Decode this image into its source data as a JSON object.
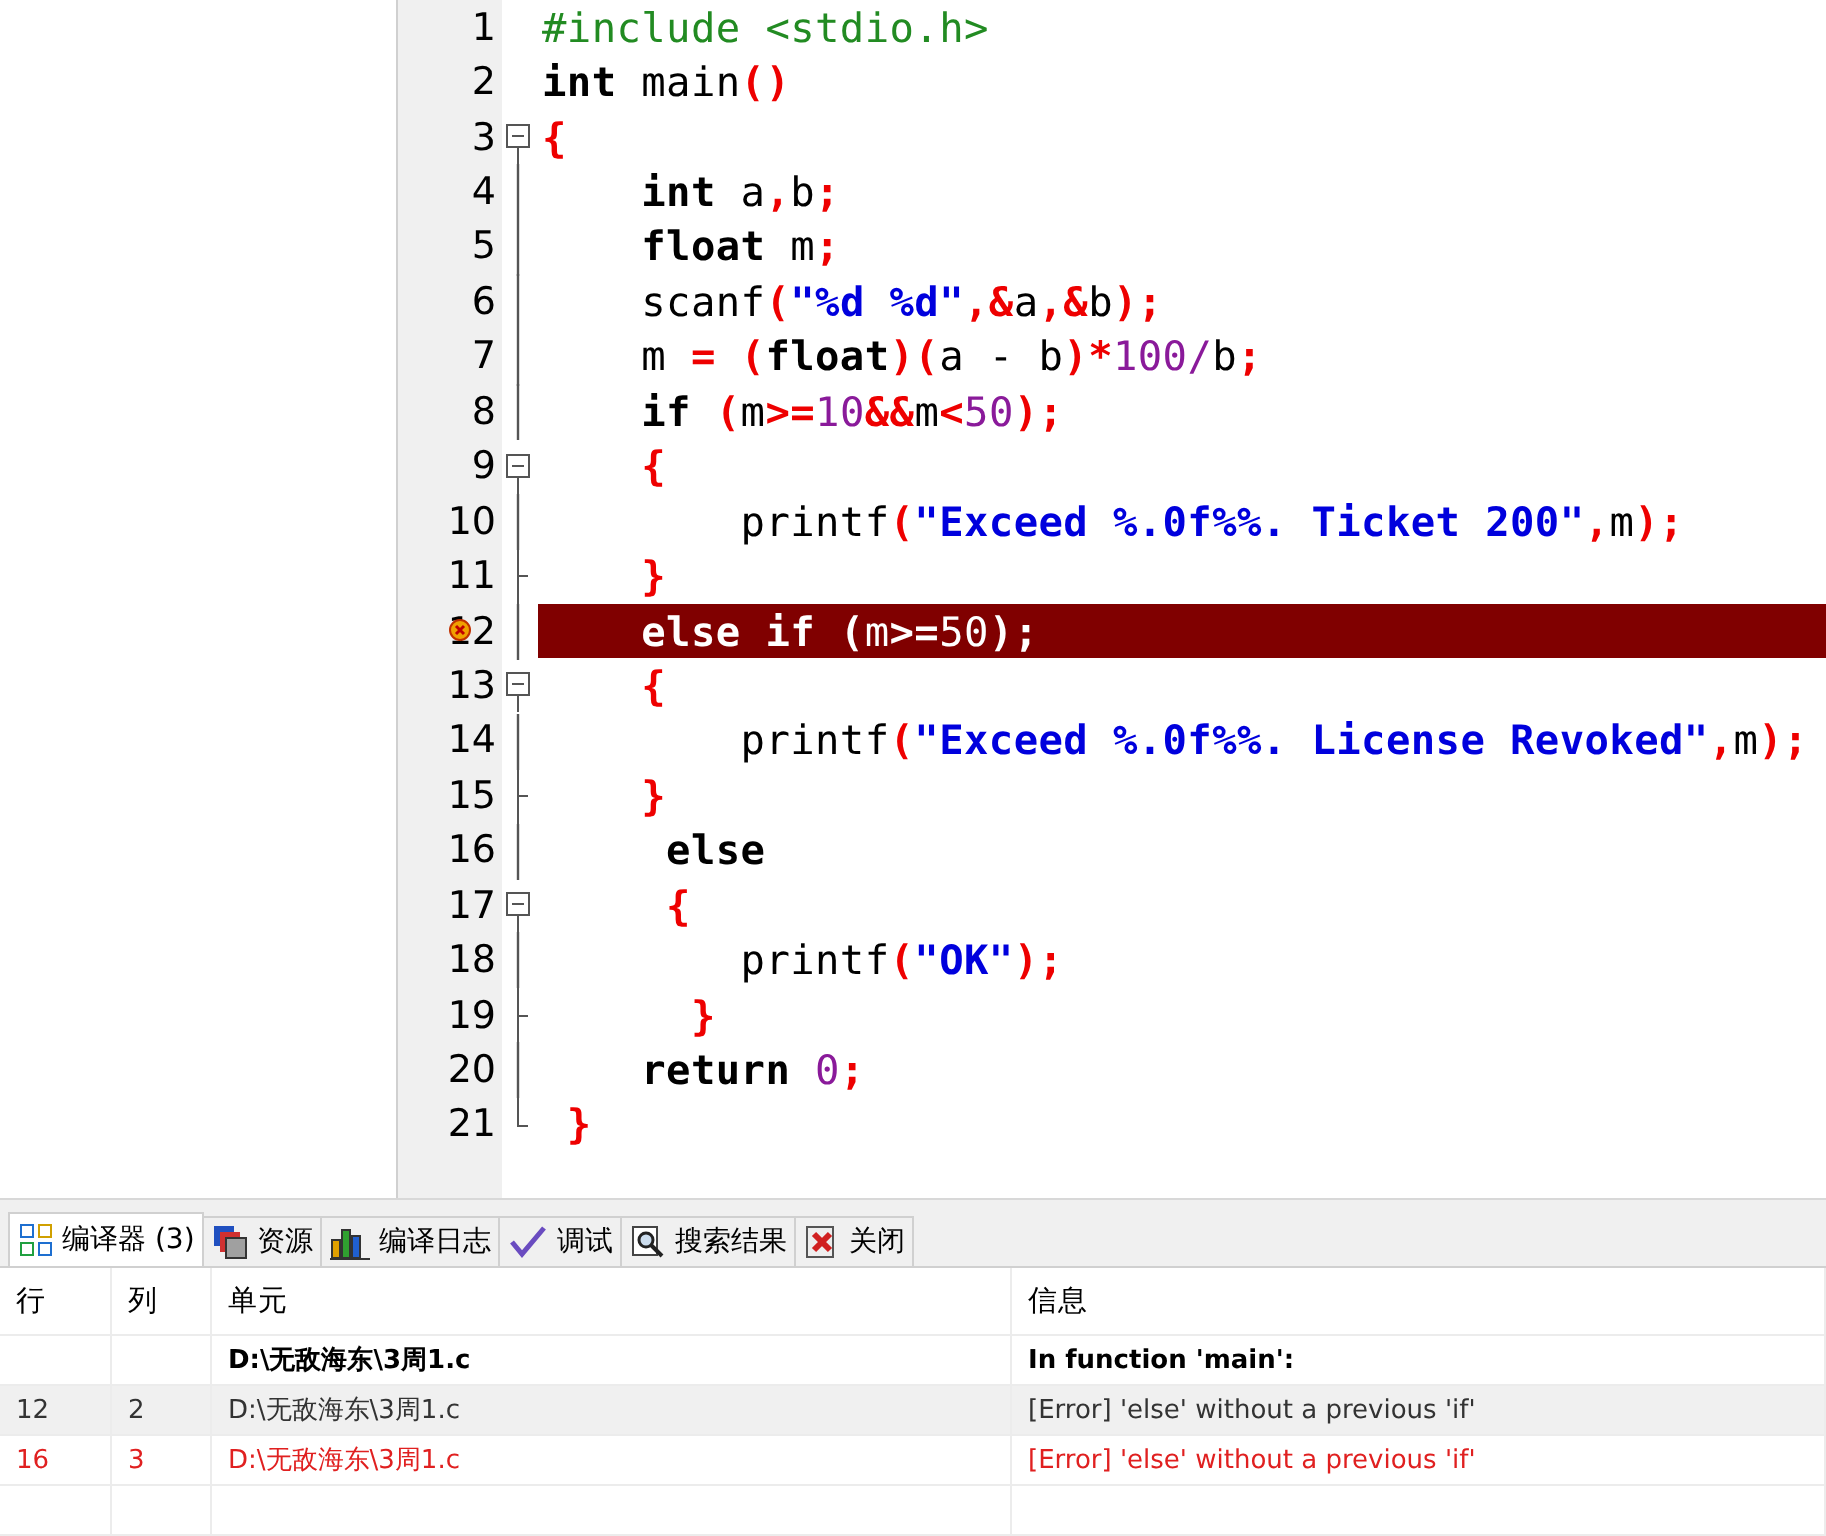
{
  "editor": {
    "lines": [
      {
        "number": "1",
        "kind": "none",
        "error": false,
        "tokens": [
          {
            "kind": "preproc",
            "text": "#include <stdio.h>"
          }
        ]
      },
      {
        "number": "2",
        "kind": "none",
        "error": false,
        "tokens": [
          {
            "kind": "keyword",
            "text": "int"
          },
          {
            "kind": "plain",
            "text": " main"
          },
          {
            "kind": "punct",
            "text": "()"
          }
        ]
      },
      {
        "number": "3",
        "kind": "start",
        "error": false,
        "tokens": [
          {
            "kind": "punct",
            "text": "{"
          }
        ]
      },
      {
        "number": "4",
        "kind": "line",
        "error": false,
        "tokens": [
          {
            "kind": "keyword",
            "text": "    int"
          },
          {
            "kind": "plain",
            "text": " a"
          },
          {
            "kind": "punct",
            "text": ","
          },
          {
            "kind": "plain",
            "text": "b"
          },
          {
            "kind": "punct",
            "text": ";"
          }
        ]
      },
      {
        "number": "5",
        "kind": "line",
        "error": false,
        "tokens": [
          {
            "kind": "keyword",
            "text": "    float"
          },
          {
            "kind": "plain",
            "text": " m"
          },
          {
            "kind": "punct",
            "text": ";"
          }
        ]
      },
      {
        "number": "6",
        "kind": "line",
        "error": false,
        "tokens": [
          {
            "kind": "plain",
            "text": "    scanf"
          },
          {
            "kind": "punct",
            "text": "("
          },
          {
            "kind": "string",
            "text": "\"%d %d\""
          },
          {
            "kind": "punct",
            "text": ",&"
          },
          {
            "kind": "plain",
            "text": "a"
          },
          {
            "kind": "punct",
            "text": ",&"
          },
          {
            "kind": "plain",
            "text": "b"
          },
          {
            "kind": "punct",
            "text": ");"
          }
        ]
      },
      {
        "number": "7",
        "kind": "line",
        "error": false,
        "tokens": [
          {
            "kind": "plain",
            "text": "    m "
          },
          {
            "kind": "punct",
            "text": "= ("
          },
          {
            "kind": "keyword",
            "text": "float"
          },
          {
            "kind": "punct",
            "text": ")("
          },
          {
            "kind": "plain",
            "text": "a - b"
          },
          {
            "kind": "punct",
            "text": ")*"
          },
          {
            "kind": "number",
            "text": "100/"
          },
          {
            "kind": "plain",
            "text": "b"
          },
          {
            "kind": "punct",
            "text": ";"
          }
        ]
      },
      {
        "number": "8",
        "kind": "line",
        "error": false,
        "tokens": [
          {
            "kind": "keyword",
            "text": "    if"
          },
          {
            "kind": "punct",
            "text": " ("
          },
          {
            "kind": "plain",
            "text": "m"
          },
          {
            "kind": "punct",
            "text": ">="
          },
          {
            "kind": "number",
            "text": "10"
          },
          {
            "kind": "punct",
            "text": "&&"
          },
          {
            "kind": "plain",
            "text": "m"
          },
          {
            "kind": "punct",
            "text": "<"
          },
          {
            "kind": "number",
            "text": "50"
          },
          {
            "kind": "punct",
            "text": ");"
          }
        ]
      },
      {
        "number": "9",
        "kind": "start",
        "error": false,
        "tokens": [
          {
            "kind": "punct",
            "text": "    {"
          }
        ]
      },
      {
        "number": "10",
        "kind": "line",
        "error": false,
        "tokens": [
          {
            "kind": "plain",
            "text": "        printf"
          },
          {
            "kind": "punct",
            "text": "("
          },
          {
            "kind": "string",
            "text": "\"Exceed %.0f%%. Ticket 200\""
          },
          {
            "kind": "punct",
            "text": ","
          },
          {
            "kind": "plain",
            "text": "m"
          },
          {
            "kind": "punct",
            "text": ");"
          }
        ]
      },
      {
        "number": "11",
        "kind": "branch",
        "error": false,
        "tokens": [
          {
            "kind": "punct",
            "text": "    }"
          }
        ]
      },
      {
        "number": "12",
        "kind": "line",
        "error": true,
        "tokens": [
          {
            "kind": "keyword",
            "text": "    else if"
          },
          {
            "kind": "punct",
            "text": " ("
          },
          {
            "kind": "plain",
            "text": "m"
          },
          {
            "kind": "punct",
            "text": ">="
          },
          {
            "kind": "number",
            "text": "50"
          },
          {
            "kind": "punct",
            "text": ");"
          }
        ]
      },
      {
        "number": "13",
        "kind": "start",
        "error": false,
        "tokens": [
          {
            "kind": "punct",
            "text": "    {"
          }
        ]
      },
      {
        "number": "14",
        "kind": "line",
        "error": false,
        "tokens": [
          {
            "kind": "plain",
            "text": "        printf"
          },
          {
            "kind": "punct",
            "text": "("
          },
          {
            "kind": "string",
            "text": "\"Exceed %.0f%%. License Revoked\""
          },
          {
            "kind": "punct",
            "text": ","
          },
          {
            "kind": "plain",
            "text": "m"
          },
          {
            "kind": "punct",
            "text": ");"
          }
        ]
      },
      {
        "number": "15",
        "kind": "branch",
        "error": false,
        "tokens": [
          {
            "kind": "punct",
            "text": "    }"
          }
        ]
      },
      {
        "number": "16",
        "kind": "line",
        "error": false,
        "tokens": [
          {
            "kind": "keyword",
            "text": "     else"
          }
        ]
      },
      {
        "number": "17",
        "kind": "start",
        "error": false,
        "tokens": [
          {
            "kind": "punct",
            "text": "     {"
          }
        ]
      },
      {
        "number": "18",
        "kind": "line",
        "error": false,
        "tokens": [
          {
            "kind": "plain",
            "text": "        printf"
          },
          {
            "kind": "punct",
            "text": "("
          },
          {
            "kind": "string",
            "text": "\"OK\""
          },
          {
            "kind": "punct",
            "text": ");"
          }
        ]
      },
      {
        "number": "19",
        "kind": "branch",
        "error": false,
        "tokens": [
          {
            "kind": "punct",
            "text": "      }"
          }
        ]
      },
      {
        "number": "20",
        "kind": "line",
        "error": false,
        "tokens": [
          {
            "kind": "keyword",
            "text": "    return"
          },
          {
            "kind": "number",
            "text": " 0"
          },
          {
            "kind": "punct",
            "text": ";"
          }
        ]
      },
      {
        "number": "21",
        "kind": "end",
        "error": false,
        "tokens": [
          {
            "kind": "punct",
            "text": " }"
          }
        ]
      }
    ]
  },
  "tabs": [
    {
      "label": "编译器 (3)",
      "kind": "grid",
      "selected": true
    },
    {
      "label": "资源",
      "kind": "stack",
      "selected": false
    },
    {
      "label": "编译日志",
      "kind": "bars",
      "selected": false
    },
    {
      "label": "调试",
      "kind": "check",
      "selected": false
    },
    {
      "label": "搜索结果",
      "kind": "search",
      "selected": false
    },
    {
      "label": "关闭",
      "kind": "close",
      "selected": false
    }
  ],
  "table": {
    "columns": [
      "行",
      "列",
      "单元",
      "信息"
    ],
    "rows": [
      {
        "kind": "heading",
        "selected": false,
        "unit": "D:\\无敌海东\\3周1.c",
        "message": "In function 'main':"
      },
      {
        "kind": "normal",
        "selected": true,
        "line": "12",
        "column": "2",
        "unit": "D:\\无敌海东\\3周1.c",
        "message": "[Error] 'else' without a previous 'if'"
      },
      {
        "kind": "error",
        "selected": false,
        "line": "16",
        "column": "3",
        "unit": "D:\\无敌海东\\3周1.c",
        "message": "[Error] 'else' without a previous 'if'"
      }
    ]
  }
}
